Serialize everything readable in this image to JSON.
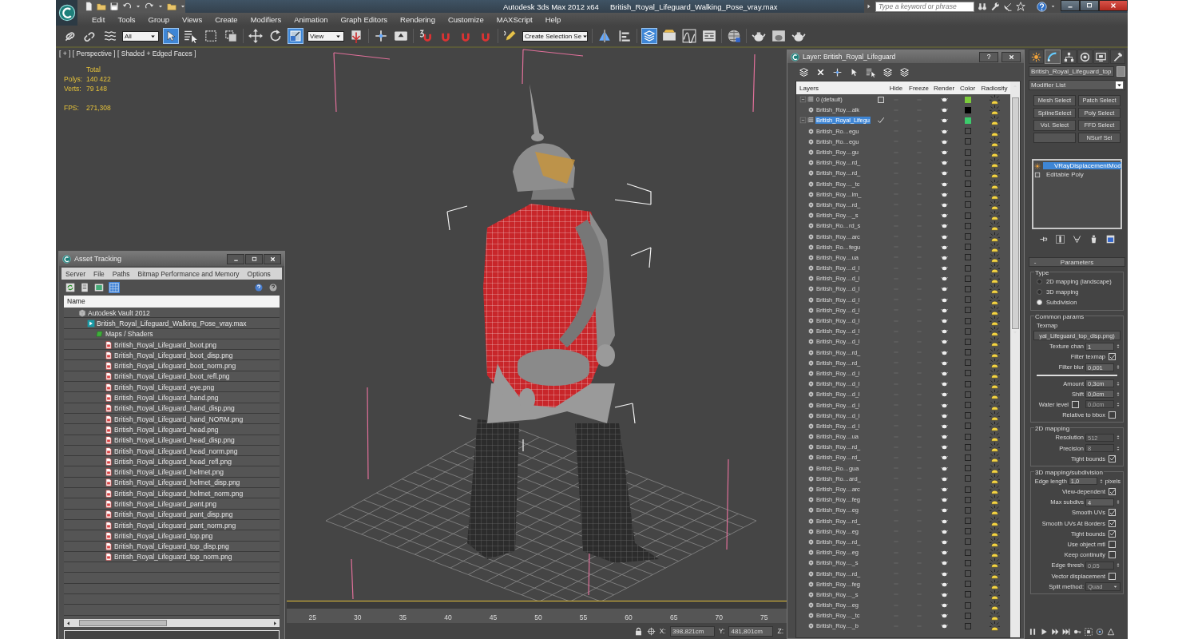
{
  "title_bar": {
    "app": "Autodesk 3ds Max  2012 x64",
    "file": "British_Royal_Lifeguard_Walking_Pose_vray.max",
    "search": {
      "placeholder": "Type a keyword or phrase"
    }
  },
  "menu_bar": [
    "Edit",
    "Tools",
    "Group",
    "Views",
    "Create",
    "Modifiers",
    "Animation",
    "Graph Editors",
    "Rendering",
    "Customize",
    "MAXScript",
    "Help"
  ],
  "toolbar": {
    "selection_filter": "All",
    "reference_coordinates": "View",
    "named_selection": "Create Selection Se",
    "tools": [
      {
        "active": false
      },
      {
        "active": false
      },
      {
        "active": false
      },
      {
        "active": true
      },
      {
        "active": false
      },
      {
        "active": false
      },
      {
        "active": false
      },
      {
        "active": false
      },
      {
        "active": false
      },
      {
        "active": true
      },
      {
        "active": false
      },
      {
        "active": false
      },
      {
        "active": false
      },
      {
        "active": false
      },
      {
        "active": false
      },
      {
        "active": false
      },
      {
        "active": false
      },
      {
        "active": false
      },
      {
        "active": false
      },
      {
        "active": false
      },
      {
        "active": true
      },
      {
        "active": false
      },
      {
        "active": false
      },
      {
        "active": false
      },
      {
        "active": false
      },
      {
        "active": false
      },
      {
        "active": false
      },
      {
        "active": false
      }
    ]
  },
  "viewport": {
    "label": "[ + ] [ Perspective ] [ Shaded + Edged Faces ]",
    "stats_header": "Total",
    "stats": [
      {
        "label": "Polys:",
        "value": "140 422"
      },
      {
        "label": "Verts:",
        "value": "79 148"
      },
      {
        "label": "FPS:",
        "value": "271,308"
      }
    ]
  },
  "timeline": {
    "ticks": [
      "25",
      "30",
      "35",
      "40",
      "45",
      "50",
      "55",
      "60",
      "65",
      "70",
      "75"
    ]
  },
  "status_bar": {
    "x_label": "X:",
    "x": "398,821cm",
    "y_label": "Y:",
    "y": "481,801cm",
    "z_label": "Z:"
  },
  "asset_tracking": {
    "title": "Asset Tracking",
    "menu": [
      "Server",
      "File",
      "Paths",
      "Bitmap Performance and Memory",
      "Options"
    ],
    "column": "Name",
    "tree": [
      {
        "label": "Autodesk Vault 2012",
        "kind": "vault",
        "selected": false,
        "children": [
          {
            "label": "British_Royal_Lifeguard_Walking_Pose_vray.max",
            "kind": "scene",
            "selected": false,
            "children": [
              {
                "label": "Maps / Shaders",
                "kind": "folder",
                "selected": false,
                "children": [
                  {
                    "label": "British_Royal_Lifeguard_boot.png",
                    "kind": "bitmap",
                    "selected": false
                  },
                  {
                    "label": "British_Royal_Lifeguard_boot_disp.png",
                    "kind": "bitmap",
                    "selected": false
                  },
                  {
                    "label": "British_Royal_Lifeguard_boot_norm.png",
                    "kind": "bitmap",
                    "selected": false
                  },
                  {
                    "label": "British_Royal_Lifeguard_boot_refl.png",
                    "kind": "bitmap",
                    "selected": false
                  },
                  {
                    "label": "British_Royal_Lifeguard_eye.png",
                    "kind": "bitmap",
                    "selected": false
                  },
                  {
                    "label": "British_Royal_Lifeguard_hand.png",
                    "kind": "bitmap",
                    "selected": false
                  },
                  {
                    "label": "British_Royal_Lifeguard_hand_disp.png",
                    "kind": "bitmap",
                    "selected": false
                  },
                  {
                    "label": "British_Royal_Lifeguard_hand_NORM.png",
                    "kind": "bitmap",
                    "selected": false
                  },
                  {
                    "label": "British_Royal_Lifeguard_head.png",
                    "kind": "bitmap",
                    "selected": false
                  },
                  {
                    "label": "British_Royal_Lifeguard_head_disp.png",
                    "kind": "bitmap",
                    "selected": false
                  },
                  {
                    "label": "British_Royal_Lifeguard_head_norm.png",
                    "kind": "bitmap",
                    "selected": false
                  },
                  {
                    "label": "British_Royal_Lifeguard_head_refl.png",
                    "kind": "bitmap",
                    "selected": false
                  },
                  {
                    "label": "British_Royal_Lifeguard_helmet.png",
                    "kind": "bitmap",
                    "selected": false
                  },
                  {
                    "label": "British_Royal_Lifeguard_helmet_disp.png",
                    "kind": "bitmap",
                    "selected": false
                  },
                  {
                    "label": "British_Royal_Lifeguard_helmet_norm.png",
                    "kind": "bitmap",
                    "selected": false
                  },
                  {
                    "label": "British_Royal_Lifeguard_pant.png",
                    "kind": "bitmap",
                    "selected": false
                  },
                  {
                    "label": "British_Royal_Lifeguard_pant_disp.png",
                    "kind": "bitmap",
                    "selected": false
                  },
                  {
                    "label": "British_Royal_Lifeguard_pant_norm.png",
                    "kind": "bitmap",
                    "selected": false
                  },
                  {
                    "label": "British_Royal_Lifeguard_top.png",
                    "kind": "bitmap",
                    "selected": false
                  },
                  {
                    "label": "British_Royal_Lifeguard_top_disp.png",
                    "kind": "bitmap",
                    "selected": false
                  },
                  {
                    "label": "British_Royal_Lifeguard_top_norm.png",
                    "kind": "bitmap",
                    "selected": false
                  }
                ]
              }
            ]
          }
        ]
      }
    ]
  },
  "layer_manager": {
    "title": "Layer: British_Royal_Lifeguard",
    "help": "?",
    "columns": [
      "Layers",
      "Hide",
      "Freeze",
      "Render",
      "Color",
      "Radiosity"
    ],
    "layers": [
      {
        "name": "0 (default)",
        "kind": "layer",
        "expanded": true,
        "selected": false,
        "current": false,
        "color": "#7ccc3c",
        "children": [
          {
            "name": "British_Roy…alk",
            "kind": "object",
            "selected": false,
            "color": "#000000"
          }
        ]
      },
      {
        "name": "British_Royal_Lifegu",
        "kind": "layer",
        "expanded": true,
        "selected": true,
        "current": true,
        "color": "#3ccc6c",
        "children": [
          {
            "name": "British_Ro…egu",
            "kind": "object",
            "selected": false
          },
          {
            "name": "British_Ro…egu",
            "kind": "object",
            "selected": false
          },
          {
            "name": "British_Roy…gu",
            "kind": "object",
            "selected": false
          },
          {
            "name": "British_Roy…rd_",
            "kind": "object",
            "selected": false
          },
          {
            "name": "British_Roy…rd_",
            "kind": "object",
            "selected": false
          },
          {
            "name": "British_Roy…_tc",
            "kind": "object",
            "selected": false
          },
          {
            "name": "British_Roy…lm_",
            "kind": "object",
            "selected": false
          },
          {
            "name": "British_Roy…rd_",
            "kind": "object",
            "selected": false
          },
          {
            "name": "British_Roy…_s",
            "kind": "object",
            "selected": false
          },
          {
            "name": "British_Ro…rd_s",
            "kind": "object",
            "selected": false
          },
          {
            "name": "British_Roy…arc",
            "kind": "object",
            "selected": false
          },
          {
            "name": "British_Ro…fegu",
            "kind": "object",
            "selected": false
          },
          {
            "name": "British_Roy…ua",
            "kind": "object",
            "selected": false
          },
          {
            "name": "British_Roy…d_l",
            "kind": "object",
            "selected": false
          },
          {
            "name": "British_Roy…d_l",
            "kind": "object",
            "selected": false
          },
          {
            "name": "British_Roy…d_l",
            "kind": "object",
            "selected": false
          },
          {
            "name": "British_Roy…d_l",
            "kind": "object",
            "selected": false
          },
          {
            "name": "British_Roy…d_l",
            "kind": "object",
            "selected": false
          },
          {
            "name": "British_Roy…d_l",
            "kind": "object",
            "selected": false
          },
          {
            "name": "British_Roy…d_l",
            "kind": "object",
            "selected": false
          },
          {
            "name": "British_Roy…d_l",
            "kind": "object",
            "selected": false
          },
          {
            "name": "British_Roy…rd_",
            "kind": "object",
            "selected": false
          },
          {
            "name": "British_Roy…rd_",
            "kind": "object",
            "selected": false
          },
          {
            "name": "British_Roy…d_l",
            "kind": "object",
            "selected": false
          },
          {
            "name": "British_Roy…d_l",
            "kind": "object",
            "selected": false
          },
          {
            "name": "British_Roy…d_l",
            "kind": "object",
            "selected": false
          },
          {
            "name": "British_Roy…d_l",
            "kind": "object",
            "selected": false
          },
          {
            "name": "British_Roy…d_l",
            "kind": "object",
            "selected": false
          },
          {
            "name": "British_Roy…d_l",
            "kind": "object",
            "selected": false
          },
          {
            "name": "British_Roy…ua",
            "kind": "object",
            "selected": false
          },
          {
            "name": "British_Roy…rd_",
            "kind": "object",
            "selected": false
          },
          {
            "name": "British_Roy…rd_",
            "kind": "object",
            "selected": false
          },
          {
            "name": "British_Ro…gua",
            "kind": "object",
            "selected": false
          },
          {
            "name": "British_Ro…ard_",
            "kind": "object",
            "selected": false
          },
          {
            "name": "British_Roy…arc",
            "kind": "object",
            "selected": false
          },
          {
            "name": "British_Roy…feg",
            "kind": "object",
            "selected": false
          },
          {
            "name": "British_Roy…eg",
            "kind": "object",
            "selected": false
          },
          {
            "name": "British_Roy…rd_",
            "kind": "object",
            "selected": false
          },
          {
            "name": "British_Roy…eg",
            "kind": "object",
            "selected": false
          },
          {
            "name": "British_Roy…rd_",
            "kind": "object",
            "selected": false
          },
          {
            "name": "British_Roy…eg",
            "kind": "object",
            "selected": false
          },
          {
            "name": "British_Roy…_s",
            "kind": "object",
            "selected": false
          },
          {
            "name": "British_Roy…rd_",
            "kind": "object",
            "selected": false
          },
          {
            "name": "British_Roy…feg",
            "kind": "object",
            "selected": false
          },
          {
            "name": "British_Roy…_s",
            "kind": "object",
            "selected": false
          },
          {
            "name": "British_Roy…eg",
            "kind": "object",
            "selected": false
          },
          {
            "name": "British_Roy…_tc",
            "kind": "object",
            "selected": false
          },
          {
            "name": "British_Roy…_b",
            "kind": "object",
            "selected": false
          }
        ]
      }
    ]
  },
  "command_panel": {
    "tabs": [
      {
        "selected": false
      },
      {
        "selected": true
      },
      {
        "selected": false
      },
      {
        "selected": false
      },
      {
        "selected": false
      },
      {
        "selected": false
      }
    ],
    "object_name": "British_Royal_Lifeguard_top",
    "modifier_list": "Modifier List",
    "modifier_buttons": [
      {
        "kind": "button",
        "label": "Mesh Select"
      },
      {
        "kind": "button",
        "label": "Patch Select"
      },
      {
        "kind": "button",
        "label": "SplineSelect"
      },
      {
        "kind": "button",
        "label": "Poly Select"
      },
      {
        "kind": "button",
        "label": "Vol. Select"
      },
      {
        "kind": "button",
        "label": "FFD Select"
      },
      {
        "kind": "blank"
      },
      {
        "kind": "button",
        "label": "NSurf Sel"
      }
    ],
    "stack": [
      {
        "label": "VRayDisplacementMod",
        "kind": "modifier",
        "selected": true
      },
      {
        "label": "Editable Poly",
        "kind": "base",
        "selected": false
      }
    ],
    "rollout": {
      "toggle": "-",
      "title": "Parameters",
      "groups": [
        {
          "title": "Type",
          "rows": [
            {
              "kind": "radio",
              "label": "2D mapping (landscape)",
              "selected": false
            },
            {
              "kind": "radio",
              "label": "3D mapping",
              "selected": false
            },
            {
              "kind": "radio",
              "label": "Subdivision",
              "selected": true
            }
          ]
        },
        {
          "title": "Common params",
          "rows": [
            {
              "kind": "label",
              "label": "Texmap"
            },
            {
              "kind": "map_button",
              "value": "yal_Lifeguard_top_disp.png)"
            },
            {
              "kind": "spinner",
              "label": "Texture chan",
              "value": "1",
              "disabled": false
            },
            {
              "kind": "check",
              "label": "Filter texmap",
              "checked": true
            },
            {
              "kind": "spinner",
              "label": "Filter blur",
              "value": "0,001",
              "disabled": false
            },
            {
              "kind": "separator"
            },
            {
              "kind": "spinner",
              "label": "Amount",
              "value": "0,3cm",
              "disabled": false
            },
            {
              "kind": "spinner",
              "label": "Shift",
              "value": "0,0cm",
              "disabled": false
            },
            {
              "kind": "check_spinner",
              "label": "Water level",
              "checked": false,
              "value": "0,0cm",
              "disabled": true
            },
            {
              "kind": "check",
              "label": "Relative to bbox",
              "checked": false
            }
          ]
        },
        {
          "title": "2D mapping",
          "rows": [
            {
              "kind": "spinner",
              "label": "Resolution",
              "value": "512",
              "disabled": true
            },
            {
              "kind": "spinner",
              "label": "Precision",
              "value": "8",
              "disabled": true
            },
            {
              "kind": "check",
              "label": "Tight bounds",
              "checked": true
            }
          ]
        },
        {
          "title": "3D mapping/subdivision",
          "rows": [
            {
              "kind": "spinner",
              "label": "Edge length",
              "value": "1,0",
              "unit": "pixels",
              "disabled": false
            },
            {
              "kind": "check",
              "label": "View-dependent",
              "checked": true
            },
            {
              "kind": "spinner",
              "label": "Max subdivs",
              "value": "4",
              "disabled": false
            },
            {
              "kind": "check",
              "label": "Smooth UVs",
              "checked": true
            },
            {
              "kind": "check",
              "label": "Smooth UVs At Borders",
              "checked": true
            },
            {
              "kind": "check",
              "label": "Tight bounds",
              "checked": true
            },
            {
              "kind": "check",
              "label": "Use object mtl",
              "checked": false
            },
            {
              "kind": "check",
              "label": "Keep continuity",
              "checked": false
            },
            {
              "kind": "spinner",
              "label": "Edge thresh",
              "value": "0,05",
              "disabled": true
            },
            {
              "kind": "check",
              "label": "Vector displacement",
              "checked": false
            },
            {
              "kind": "dropdown",
              "label": "Split method:",
              "value": "Quad",
              "disabled": true
            }
          ]
        }
      ]
    }
  }
}
